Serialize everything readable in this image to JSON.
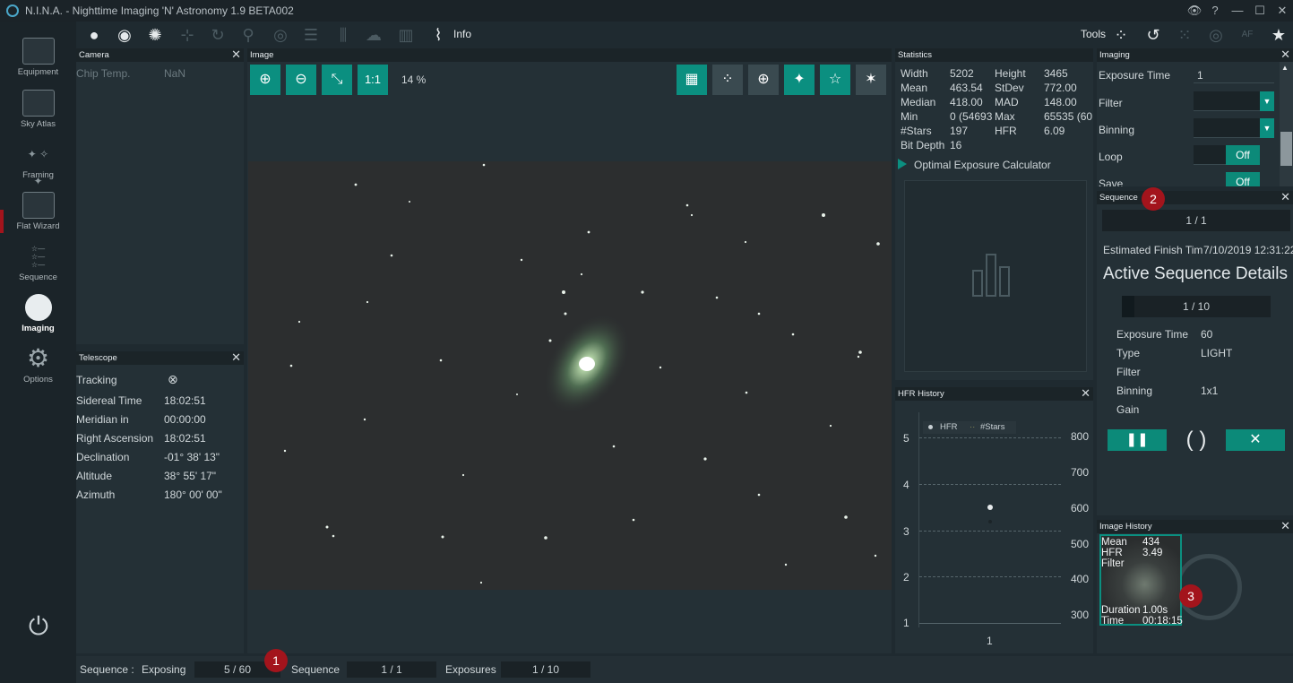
{
  "window": {
    "title": "N.I.N.A. - Nighttime Imaging 'N' Astronomy 1.9 BETA002"
  },
  "sidebar": {
    "items": [
      {
        "label": "Equipment"
      },
      {
        "label": "Sky Atlas"
      },
      {
        "label": "Framing"
      },
      {
        "label": "Flat Wizard"
      },
      {
        "label": "Sequence"
      },
      {
        "label": "Imaging"
      },
      {
        "label": "Options"
      }
    ]
  },
  "toolbar": {
    "info_label": "Info",
    "tools_label": "Tools"
  },
  "camera": {
    "title": "Camera",
    "chip_temp_label": "Chip Temp.",
    "chip_temp_value": "NaN"
  },
  "telescope": {
    "title": "Telescope",
    "rows": [
      {
        "label": "Tracking",
        "value": "⊗"
      },
      {
        "label": "Sidereal Time",
        "value": "18:02:51"
      },
      {
        "label": "Meridian in",
        "value": "00:00:00"
      },
      {
        "label": "Right Ascension",
        "value": "18:02:51"
      },
      {
        "label": "Declination",
        "value": "-01° 38' 13\""
      },
      {
        "label": "Altitude",
        "value": "38° 55' 17\""
      },
      {
        "label": "Azimuth",
        "value": "180° 00' 00\""
      }
    ]
  },
  "image": {
    "title": "Image",
    "zoom": "14 %",
    "one_to_one": "1:1"
  },
  "statistics": {
    "title": "Statistics",
    "rows": [
      [
        "Width",
        "5202",
        "Height",
        "3465"
      ],
      [
        "Mean",
        "463.54",
        "StDev",
        "772.00"
      ],
      [
        "Median",
        "418.00",
        "MAD",
        "148.00"
      ],
      [
        "Min",
        "0 (54693(",
        "Max",
        "65535 (60"
      ],
      [
        "#Stars",
        "197",
        "HFR",
        "6.09"
      ],
      [
        "Bit Depth",
        "16",
        "",
        ""
      ]
    ],
    "calculator_label": "Optimal Exposure Calculator"
  },
  "hfr_history": {
    "title": "HFR History",
    "legend": [
      "HFR",
      "#Stars"
    ],
    "left_ticks": [
      "5",
      "4",
      "3",
      "2",
      "1"
    ],
    "right_ticks": [
      "800",
      "700",
      "600",
      "500",
      "400",
      "300"
    ],
    "x_tick": "1"
  },
  "imaging": {
    "title": "Imaging",
    "exposure_label": "Exposure Time",
    "exposure_value": "1",
    "filter_label": "Filter",
    "binning_label": "Binning",
    "loop_label": "Loop",
    "loop_value": "Off",
    "save_label": "Save",
    "save_value": "Off"
  },
  "sequence": {
    "title": "Sequence",
    "progress": "1 / 1",
    "finish_label": "Estimated Finish Tim",
    "finish_value": "7/10/2019 12:31:22",
    "details_heading": "Active Sequence Details",
    "exposure_progress": "1 / 10",
    "rows": [
      {
        "label": "Exposure Time",
        "value": "60"
      },
      {
        "label": "Type",
        "value": "LIGHT"
      },
      {
        "label": "Filter",
        "value": ""
      },
      {
        "label": "Binning",
        "value": "1x1"
      },
      {
        "label": "Gain",
        "value": ""
      }
    ]
  },
  "image_history": {
    "title": "Image History",
    "mean_label": "Mean",
    "mean_value": "434",
    "hfr_label": "HFR",
    "hfr_value": "3.49",
    "filter_label": "Filter",
    "duration_label": "Duration",
    "duration_value": "1.00s",
    "time_label": "Time",
    "time_value": "00:18:15"
  },
  "statusbar": {
    "sequence_label": "Sequence :",
    "exposing_label": "Exposing",
    "exposing_value": "5 / 60",
    "seq_label": "Sequence",
    "seq_value": "1 / 1",
    "exposures_label": "Exposures",
    "exposures_value": "1 / 10"
  },
  "markers": [
    "1",
    "2",
    "3"
  ],
  "colors": {
    "accent": "#0b8f80",
    "marker": "#a3141c",
    "background": "#1f2a30"
  }
}
